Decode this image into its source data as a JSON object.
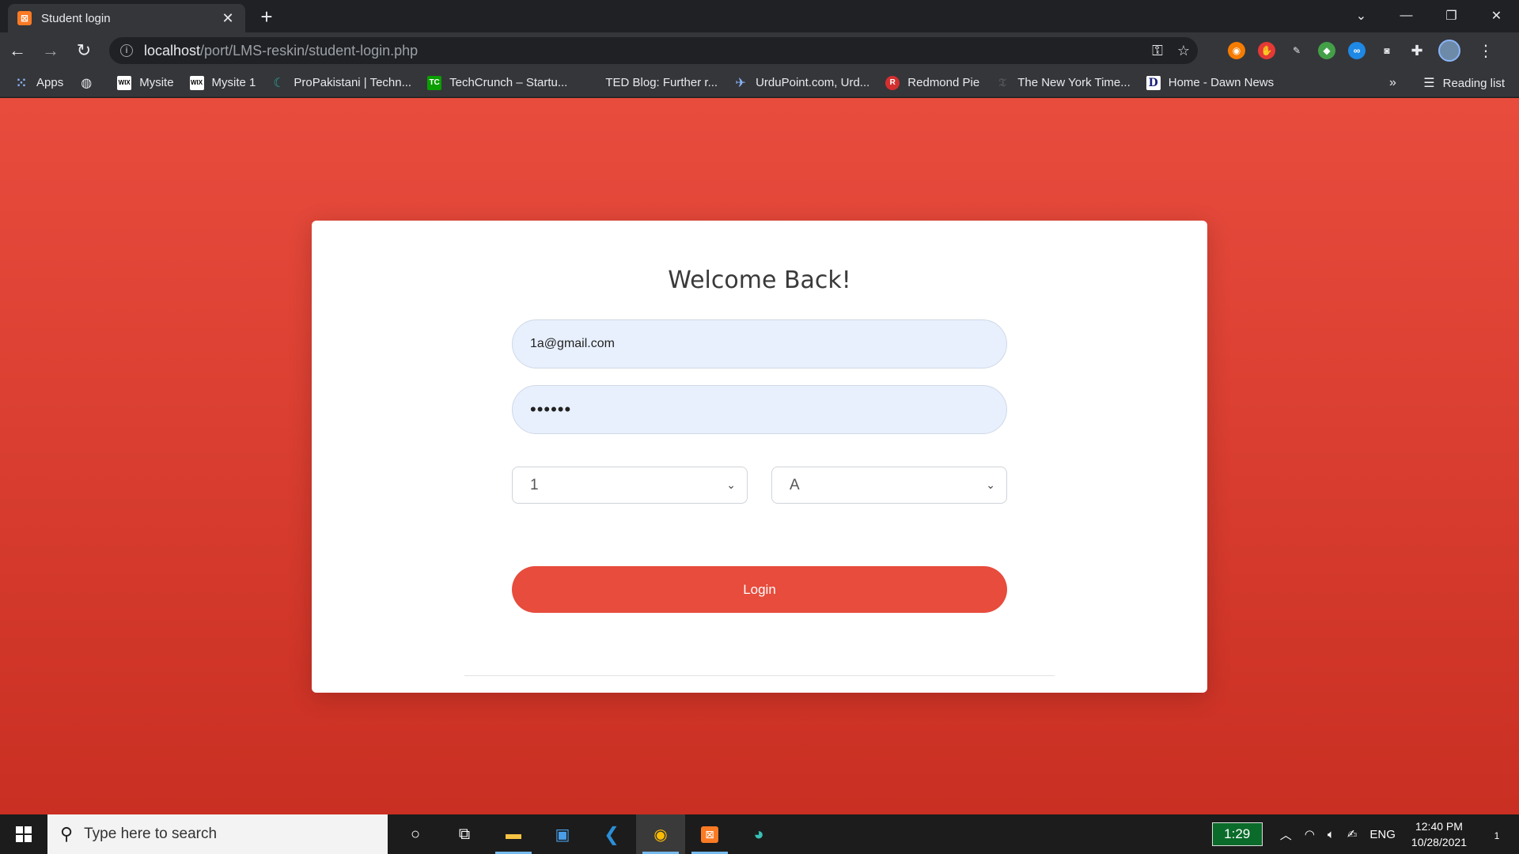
{
  "browser": {
    "tab_title": "Student login",
    "tab_favicon": "xampp-icon",
    "url_host": "localhost",
    "url_path": "/port/LMS-reskin/student-login.php",
    "reading_list": "Reading list",
    "more_bookmarks": "»"
  },
  "bookmarks": [
    {
      "label": "Apps",
      "icon": "apps-grid-icon"
    },
    {
      "label": "",
      "icon": "globe-icon"
    },
    {
      "label": "Mysite",
      "icon": "wix-icon"
    },
    {
      "label": "Mysite 1",
      "icon": "wix-icon"
    },
    {
      "label": "ProPakistani | Techn...",
      "icon": "propakistani-icon"
    },
    {
      "label": "TechCrunch – Startu...",
      "icon": "techcrunch-icon"
    },
    {
      "label": "TED Blog: Further r...",
      "icon": "ted-icon"
    },
    {
      "label": "UrduPoint.com, Urd...",
      "icon": "urdupoint-icon"
    },
    {
      "label": "Redmond Pie",
      "icon": "redmondpie-icon"
    },
    {
      "label": "The New York Time...",
      "icon": "nyt-icon"
    },
    {
      "label": "Home - Dawn News",
      "icon": "dawn-icon"
    }
  ],
  "login": {
    "title": "Welcome Back!",
    "email_value": "1a@gmail.com",
    "password_value": "••••••",
    "class_select": "1",
    "section_select": "A",
    "login_label": "Login"
  },
  "taskbar": {
    "search_placeholder": "Type here to search",
    "battery_time": "1:29",
    "language": "ENG",
    "time": "12:40 PM",
    "date": "10/28/2021",
    "notification_count": "1"
  },
  "colors": {
    "accent": "#e74c3c",
    "page_gradient_top": "#e84c3d",
    "page_gradient_bottom": "#c92f22",
    "input_bg": "#e8f0fe"
  }
}
